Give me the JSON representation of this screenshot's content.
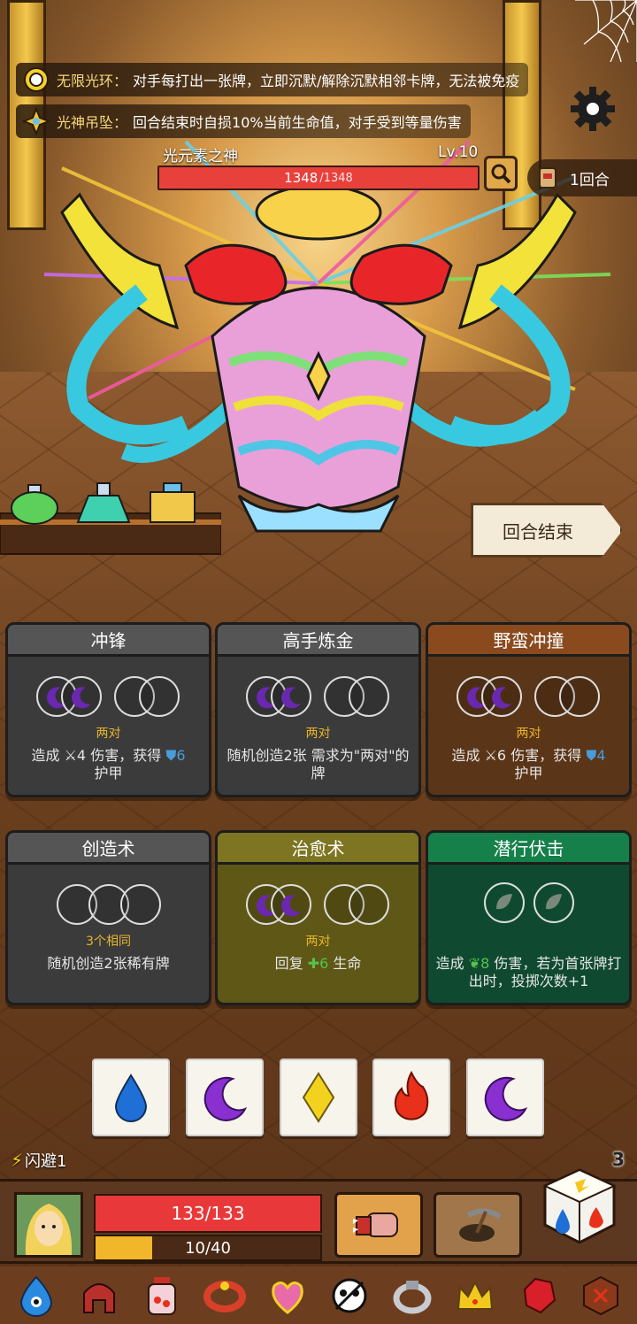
{
  "buffs": [
    {
      "name": "无限光环：",
      "text": "对手每打出一张牌，立即沉默/解除沉默相邻卡牌，无法被免疫",
      "icon": "halo-ring-icon"
    },
    {
      "name": "光神吊坠：",
      "text": "回合结束时自损10%当前生命值，对手受到等量伤害",
      "icon": "sun-pendant-icon"
    }
  ],
  "boss": {
    "name": "光元素之神",
    "level": "Lv.10",
    "hp": "1348",
    "hp_max": "/1348",
    "hp_fraction": 1.0
  },
  "round": {
    "label": "1回合"
  },
  "end_turn_label": "回合结束",
  "cards": [
    {
      "title": "冲锋",
      "style": "gray",
      "requirement": "两对",
      "desc_pre": "造成",
      "desc_num1": "4",
      "desc_mid": "伤害，获得",
      "desc_num2": "6",
      "desc_post": "护甲"
    },
    {
      "title": "高手炼金",
      "style": "gray",
      "requirement": "两对",
      "desc": "随机创造2张 需求为\"两对\"的牌"
    },
    {
      "title": "野蛮冲撞",
      "style": "brown",
      "requirement": "两对",
      "desc_pre": "造成",
      "desc_num1": "6",
      "desc_mid": "伤害，获得",
      "desc_num2": "4",
      "desc_post": "护甲"
    },
    {
      "title": "创造术",
      "style": "gray",
      "requirement": "3个相同",
      "desc": "随机创造2张稀有牌"
    },
    {
      "title": "治愈术",
      "style": "gold",
      "requirement": "两对",
      "desc_pre": "回复",
      "desc_num": "6",
      "desc_post": "生命"
    },
    {
      "title": "潜行伏击",
      "style": "green",
      "requirement": "",
      "desc_pre": "造成",
      "desc_num": "8",
      "desc_post": "伤害，若为首张牌打出时，投掷次数+1"
    }
  ],
  "dice": [
    {
      "face": "water-drop-icon",
      "color": "#1f6fd6"
    },
    {
      "face": "moon-icon",
      "color": "#8a2fd0"
    },
    {
      "face": "diamond-icon",
      "color": "#f2d21e"
    },
    {
      "face": "fire-icon",
      "color": "#e8301a"
    },
    {
      "face": "moon-icon",
      "color": "#8a2fd0"
    }
  ],
  "player": {
    "dodge": "闪避1",
    "hp": "133/133",
    "hp_fraction": 1.0,
    "xp": "10/40",
    "xp_fraction": 0.25,
    "rerolls": "3"
  },
  "relics": [
    "blue-flame-spirit-icon",
    "red-helmet-icon",
    "potion-jar-icon",
    "red-bracelet-icon",
    "heart-amulet-icon",
    "skull-emblem-icon",
    "silver-ring-icon",
    "gold-crown-icon",
    "red-gem-icon",
    "rune-shield-icon"
  ]
}
